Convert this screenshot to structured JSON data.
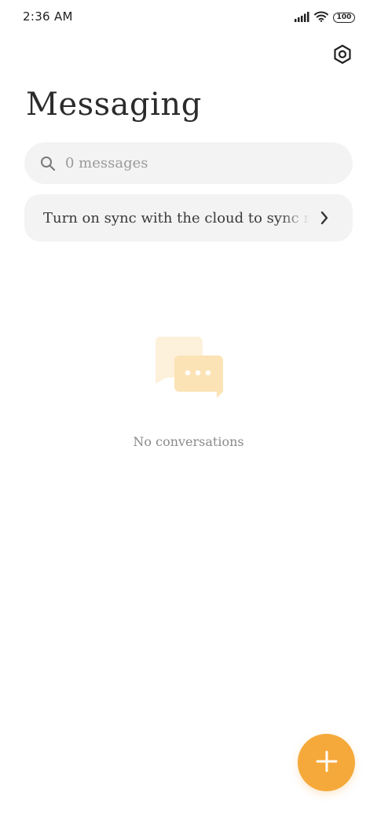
{
  "status_bar": {
    "time": "2:36 AM",
    "battery_level": "100",
    "icons": [
      "signal-icon",
      "wifi-icon",
      "battery-icon"
    ]
  },
  "header": {
    "title": "Messaging",
    "settings_icon": "settings-icon"
  },
  "search": {
    "placeholder": "0 messages",
    "icon": "search-icon"
  },
  "sync_banner": {
    "text": "Turn on sync with the cloud to sync messages",
    "icon": "chevron-right-icon"
  },
  "empty_state": {
    "icon": "chat-bubbles-icon",
    "text": "No conversations"
  },
  "fab": {
    "icon": "plus-icon"
  },
  "colors": {
    "accent": "#f5a93a",
    "illustration_light": "#fdf1dc",
    "illustration_mid": "#fbe3b6",
    "surface": "#f3f3f3",
    "title": "#2b2b2b"
  }
}
